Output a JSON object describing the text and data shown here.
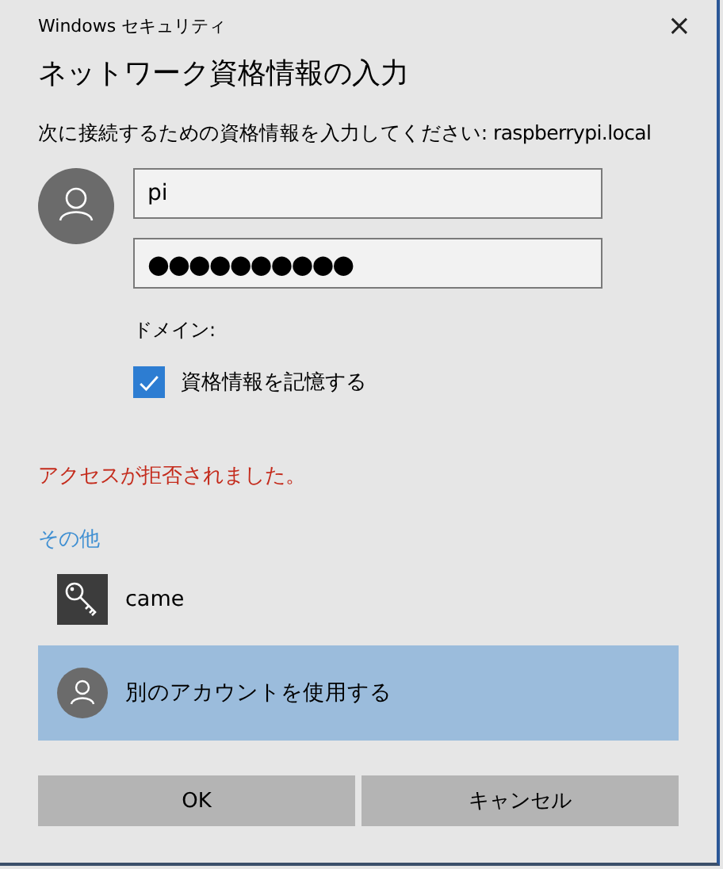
{
  "window": {
    "title": "Windows セキュリティ",
    "close": "×"
  },
  "heading": "ネットワーク資格情報の入力",
  "prompt": "次に接続するための資格情報を入力してください: raspberrypi.local",
  "username": {
    "value": "pi"
  },
  "password": {
    "value": "●●●●●●●●●●"
  },
  "domain_label": "ドメイン:",
  "remember": {
    "label": "資格情報を記憶する",
    "checked": true
  },
  "error": "アクセスが拒否されました。",
  "other_label": "その他",
  "accounts": [
    {
      "kind": "key",
      "label": "came",
      "selected": false
    },
    {
      "kind": "person",
      "label": "別のアカウントを使用する",
      "selected": true
    }
  ],
  "buttons": [
    "OK",
    "キャンセル"
  ]
}
